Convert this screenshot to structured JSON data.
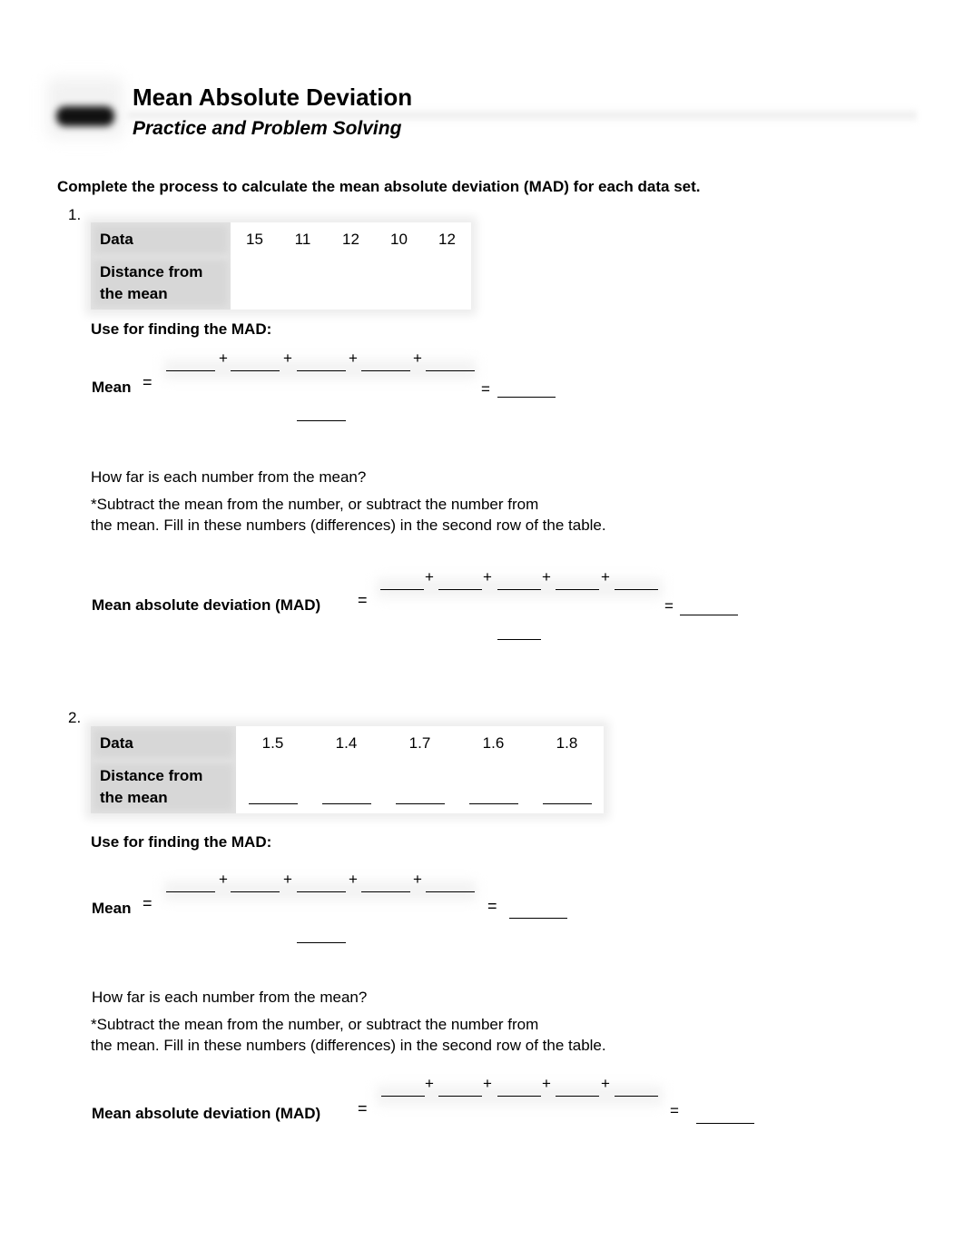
{
  "header": {
    "title": "Mean Absolute Deviation",
    "subtitle": "Practice and Problem Solving"
  },
  "instructions": "Complete the process to calculate the mean absolute deviation (MAD) for each data set.",
  "problems": [
    {
      "number": "1.",
      "table": {
        "row_labels": [
          "Data",
          "Distance from the mean"
        ],
        "row_label_lines": [
          "Data",
          "Distance from",
          "the mean"
        ],
        "data": [
          "15",
          "11",
          "12",
          "10",
          "12"
        ],
        "distances": [
          "",
          "",
          "",
          "",
          ""
        ]
      },
      "use_for_label": "Use for finding the MAD:",
      "mean_label": "Mean",
      "equals": "=",
      "plus": "+",
      "how_far": "How far is each number from the mean?",
      "subtract_line1": "*Subtract the mean from the number, or subtract the number from",
      "subtract_line2": "the mean. Fill in these numbers (differences) in the second row of the table.",
      "mad_label": "Mean absolute deviation (MAD)"
    },
    {
      "number": "2.",
      "table": {
        "row_labels": [
          "Data",
          "Distance from the mean"
        ],
        "row_label_lines": [
          "Data",
          "Distance from",
          "the mean"
        ],
        "data": [
          "1.5",
          "1.4",
          "1.7",
          "1.6",
          "1.8"
        ],
        "distances": [
          "",
          "",
          "",
          "",
          ""
        ]
      },
      "use_for_label": "Use for finding the MAD:",
      "mean_label": "Mean",
      "equals": "=",
      "plus": "+",
      "how_far": "How far is each number from the mean?",
      "subtract_line1": "*Subtract the mean from the number, or subtract the number from",
      "subtract_line2": "the mean. Fill in these numbers (differences) in the second row of the table.",
      "mad_label": "Mean absolute deviation (MAD)"
    }
  ]
}
